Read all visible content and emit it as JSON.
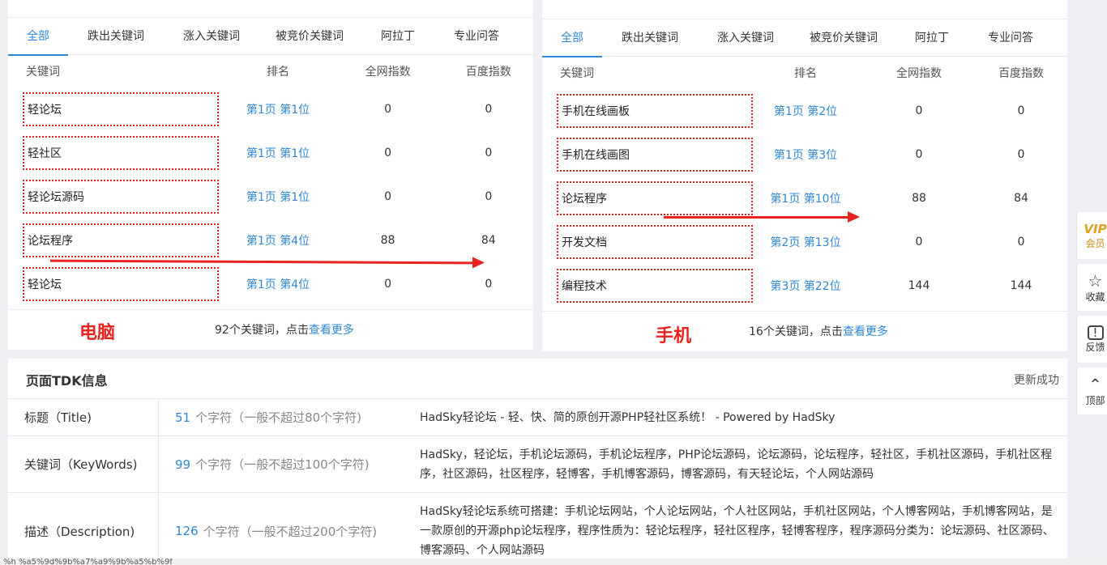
{
  "tabs": [
    "全部",
    "跌出关键词",
    "涨入关键词",
    "被竞价关键词",
    "阿拉丁",
    "专业问答"
  ],
  "table_headers": {
    "keyword": "关键词",
    "rank": "排名",
    "all_index": "全网指数",
    "baidu_index": "百度指数"
  },
  "pc": {
    "label": "电脑",
    "rows": [
      {
        "keyword": "轻论坛",
        "rank": "第1页 第1位",
        "all": "0",
        "baidu": "0"
      },
      {
        "keyword": "轻社区",
        "rank": "第1页 第1位",
        "all": "0",
        "baidu": "0"
      },
      {
        "keyword": "轻论坛源码",
        "rank": "第1页 第1位",
        "all": "0",
        "baidu": "0"
      },
      {
        "keyword": "论坛程序",
        "rank": "第1页 第4位",
        "all": "88",
        "baidu": "84"
      },
      {
        "keyword": "轻论坛",
        "rank": "第1页 第4位",
        "all": "0",
        "baidu": "0"
      }
    ],
    "footer_count": "92个关键词，点击",
    "footer_link": "查看更多"
  },
  "mobile": {
    "label": "手机",
    "rows": [
      {
        "keyword": "手机在线画板",
        "rank": "第1页 第2位",
        "all": "0",
        "baidu": "0"
      },
      {
        "keyword": "手机在线画图",
        "rank": "第1页 第3位",
        "all": "0",
        "baidu": "0"
      },
      {
        "keyword": "论坛程序",
        "rank": "第1页 第10位",
        "all": "88",
        "baidu": "84"
      },
      {
        "keyword": "开发文档",
        "rank": "第2页 第13位",
        "all": "0",
        "baidu": "0"
      },
      {
        "keyword": "编程技术",
        "rank": "第3页 第22位",
        "all": "144",
        "baidu": "144"
      }
    ],
    "footer_count": "16个关键词，点击",
    "footer_link": "查看更多"
  },
  "tdk": {
    "title": "页面TDK信息",
    "status": "更新成功",
    "rows": [
      {
        "label": "标题（Title)",
        "count": "51",
        "count_text": "个字符（一般不超过80个字符)",
        "content": "HadSky轻论坛 - 轻、快、简的原创开源PHP轻社区系统！ - Powered by HadSky"
      },
      {
        "label": "关键词（KeyWords)",
        "count": "99",
        "count_text": "个字符（一般不超过100个字符)",
        "content": "HadSky，轻论坛，手机论坛源码，手机论坛程序，PHP论坛源码，论坛源码，论坛程序，轻社区，手机社区源码，手机社区程序，社区源码，社区程序，轻博客，手机博客源码，博客源码，有天轻论坛，个人网站源码"
      },
      {
        "label": "描述（Description)",
        "count": "126",
        "count_text": "个字符（一般不超过200个字符)",
        "content": "HadSky轻论坛系统可搭建：手机论坛网站，个人论坛网站，个人社区网站，手机社区网站，个人博客网站，手机博客网站，是一款原创的开源php论坛程序，程序性质为：轻论坛程序，轻社区程序，轻博客程序，程序源码分类为：论坛源码、社区源码、博客源码、个人网站源码"
      }
    ]
  },
  "side": {
    "vip": "VIP",
    "vip_label": "会员",
    "fav": "收藏",
    "feedback": "反馈",
    "top": "顶部"
  },
  "status_bar": "%h %a5%9d%9b%a7%a9%9b%a5%b%9f",
  "colors": {
    "accent": "#2f87d6",
    "annotation_red": "#e8231f"
  }
}
